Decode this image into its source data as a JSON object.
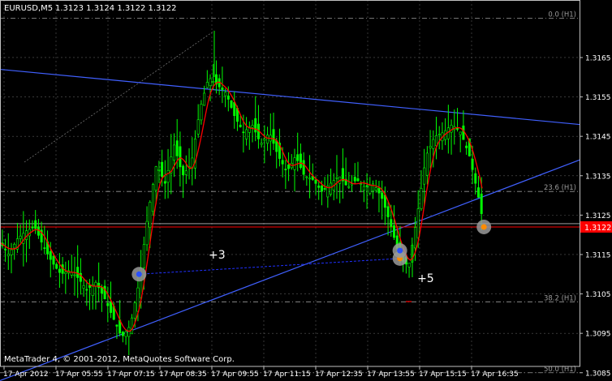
{
  "header": {
    "symbol": "EURUSD,M5",
    "ohlc": "1.3123 1.3124 1.3122 1.3122"
  },
  "footer": {
    "copyright": "MetaTrader 4, © 2001-2012, MetaQuotes Software Corp."
  },
  "current_price": "1.3122",
  "colors": {
    "background": "#000000",
    "grid": "#5a5a5a",
    "candle": "#00ff00",
    "ema_fast": "#ff0000",
    "ma_slow": "#ffffff",
    "bands": "#808080",
    "trendline": "#4060ff",
    "connector": "#2030ff",
    "bid_line": "#ff0000",
    "price_badge": "#ff0000"
  },
  "chart_data": {
    "type": "candlestick",
    "title": "EURUSD,M5",
    "ylim": [
      1.3082,
      1.318
    ],
    "y_ticks": [
      "1.3165",
      "1.3155",
      "1.3145",
      "1.3135",
      "1.3125",
      "1.3115",
      "1.3105",
      "1.3095",
      "1.3085"
    ],
    "x_ticks": [
      "17 Apr 2012",
      "17 Apr 05:55",
      "17 Apr 07:15",
      "17 Apr 08:35",
      "17 Apr 09:55",
      "17 Apr 11:15",
      "17 Apr 12:35",
      "17 Apr 13:55",
      "17 Apr 15:15",
      "17 Apr 16:35"
    ],
    "fib_levels": [
      {
        "label": "0.0 (H1)",
        "price": 1.3175
      },
      {
        "label": "23.6 (H1)",
        "price": 1.3131
      },
      {
        "label": "38.2 (H1)",
        "price": 1.3103
      },
      {
        "label": "50.0 (H1)",
        "price": 1.3085
      }
    ],
    "annotations": [
      {
        "text": "+3",
        "x": 0.36,
        "price": 1.3114
      },
      {
        "text": "+5",
        "x": 0.72,
        "price": 1.3108
      }
    ],
    "trendlines": [
      {
        "name": "upper",
        "from": [
          0.0,
          1.3162
        ],
        "to": [
          1.0,
          1.3148
        ]
      },
      {
        "name": "lower",
        "from": [
          0.0,
          1.3083
        ],
        "to": [
          1.0,
          1.3139
        ]
      }
    ],
    "markers": [
      {
        "x": 0.24,
        "price": 1.311
      },
      {
        "x": 0.69,
        "price": 1.3114
      },
      {
        "x": 0.69,
        "price": 1.3116
      },
      {
        "x": 0.835,
        "price": 1.3122
      }
    ],
    "close_path": [
      [
        0.0,
        1.3118
      ],
      [
        0.015,
        1.3115
      ],
      [
        0.03,
        1.3119
      ],
      [
        0.045,
        1.3121
      ],
      [
        0.06,
        1.3122
      ],
      [
        0.075,
        1.3117
      ],
      [
        0.09,
        1.3113
      ],
      [
        0.105,
        1.311
      ],
      [
        0.12,
        1.3111
      ],
      [
        0.135,
        1.3109
      ],
      [
        0.15,
        1.3106
      ],
      [
        0.165,
        1.3108
      ],
      [
        0.18,
        1.3104
      ],
      [
        0.195,
        1.3099
      ],
      [
        0.21,
        1.3094
      ],
      [
        0.225,
        1.3097
      ],
      [
        0.24,
        1.3108
      ],
      [
        0.255,
        1.3125
      ],
      [
        0.27,
        1.3138
      ],
      [
        0.285,
        1.3133
      ],
      [
        0.3,
        1.3143
      ],
      [
        0.315,
        1.3135
      ],
      [
        0.33,
        1.3138
      ],
      [
        0.345,
        1.3152
      ],
      [
        0.36,
        1.316
      ],
      [
        0.375,
        1.3158
      ],
      [
        0.39,
        1.3156
      ],
      [
        0.405,
        1.315
      ],
      [
        0.42,
        1.3146
      ],
      [
        0.435,
        1.3148
      ],
      [
        0.45,
        1.3143
      ],
      [
        0.465,
        1.3146
      ],
      [
        0.48,
        1.314
      ],
      [
        0.495,
        1.3136
      ],
      [
        0.51,
        1.314
      ],
      [
        0.525,
        1.3135
      ],
      [
        0.54,
        1.3134
      ],
      [
        0.555,
        1.3131
      ],
      [
        0.57,
        1.3133
      ],
      [
        0.585,
        1.3135
      ],
      [
        0.6,
        1.3132
      ],
      [
        0.615,
        1.3134
      ],
      [
        0.63,
        1.3132
      ],
      [
        0.645,
        1.3133
      ],
      [
        0.66,
        1.3129
      ],
      [
        0.675,
        1.3122
      ],
      [
        0.69,
        1.3114
      ],
      [
        0.705,
        1.3112
      ],
      [
        0.72,
        1.3125
      ],
      [
        0.735,
        1.314
      ],
      [
        0.75,
        1.3145
      ],
      [
        0.765,
        1.3146
      ],
      [
        0.78,
        1.3148
      ],
      [
        0.795,
        1.3146
      ],
      [
        0.81,
        1.314
      ],
      [
        0.825,
        1.313
      ],
      [
        0.835,
        1.3122
      ]
    ]
  }
}
